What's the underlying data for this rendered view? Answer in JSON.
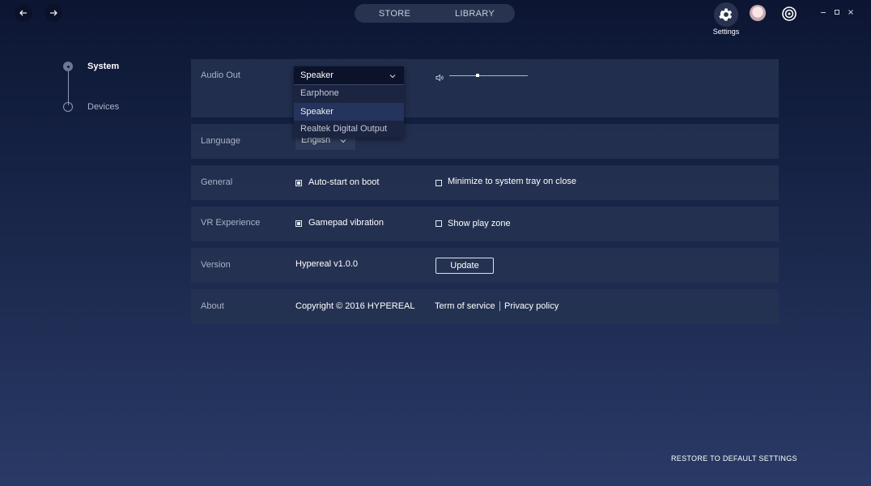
{
  "topbar": {
    "tabs": [
      "STORE",
      "LIBRARY"
    ],
    "settings_label": "Settings"
  },
  "sidebar": {
    "items": [
      {
        "label": "System",
        "active": true
      },
      {
        "label": "Devices",
        "active": false
      }
    ]
  },
  "audio": {
    "label": "Audio Out",
    "selected": "Speaker",
    "options": [
      "Earphone",
      "Speaker",
      "Realtek Digital Output"
    ],
    "volume": 0.36
  },
  "language": {
    "label": "Language",
    "value": "English"
  },
  "general": {
    "label": "General",
    "opt1": {
      "label": "Auto-start on boot",
      "checked": true
    },
    "opt2": {
      "label": "Minimize to system tray on close",
      "checked": false
    }
  },
  "vr": {
    "label": "VR Experience",
    "opt1": {
      "label": "Gamepad vibration",
      "checked": true
    },
    "opt2": {
      "label": "Show play zone",
      "checked": false
    }
  },
  "version": {
    "label": "Version",
    "value": "Hypereal v1.0.0",
    "button": "Update"
  },
  "about": {
    "label": "About",
    "copyright": "Copyright © 2016 HYPEREAL",
    "terms": "Term of service",
    "privacy": "Privacy policy"
  },
  "restore_label": "RESTORE TO DEFAULT SETTINGS",
  "icons": {
    "back": "arrow-left-icon",
    "forward": "arrow-right-icon",
    "settings": "gear-icon",
    "profile": "avatar",
    "brand": "hypereal-logo-icon",
    "volume": "speaker-icon",
    "minimize": "minimize-icon",
    "maximize": "maximize-icon",
    "close": "close-icon"
  },
  "colors": {
    "background_top": "#0c1633",
    "background_bottom": "#2a3a66",
    "panel": "#263352",
    "dropdown_selected": "#25345c"
  }
}
